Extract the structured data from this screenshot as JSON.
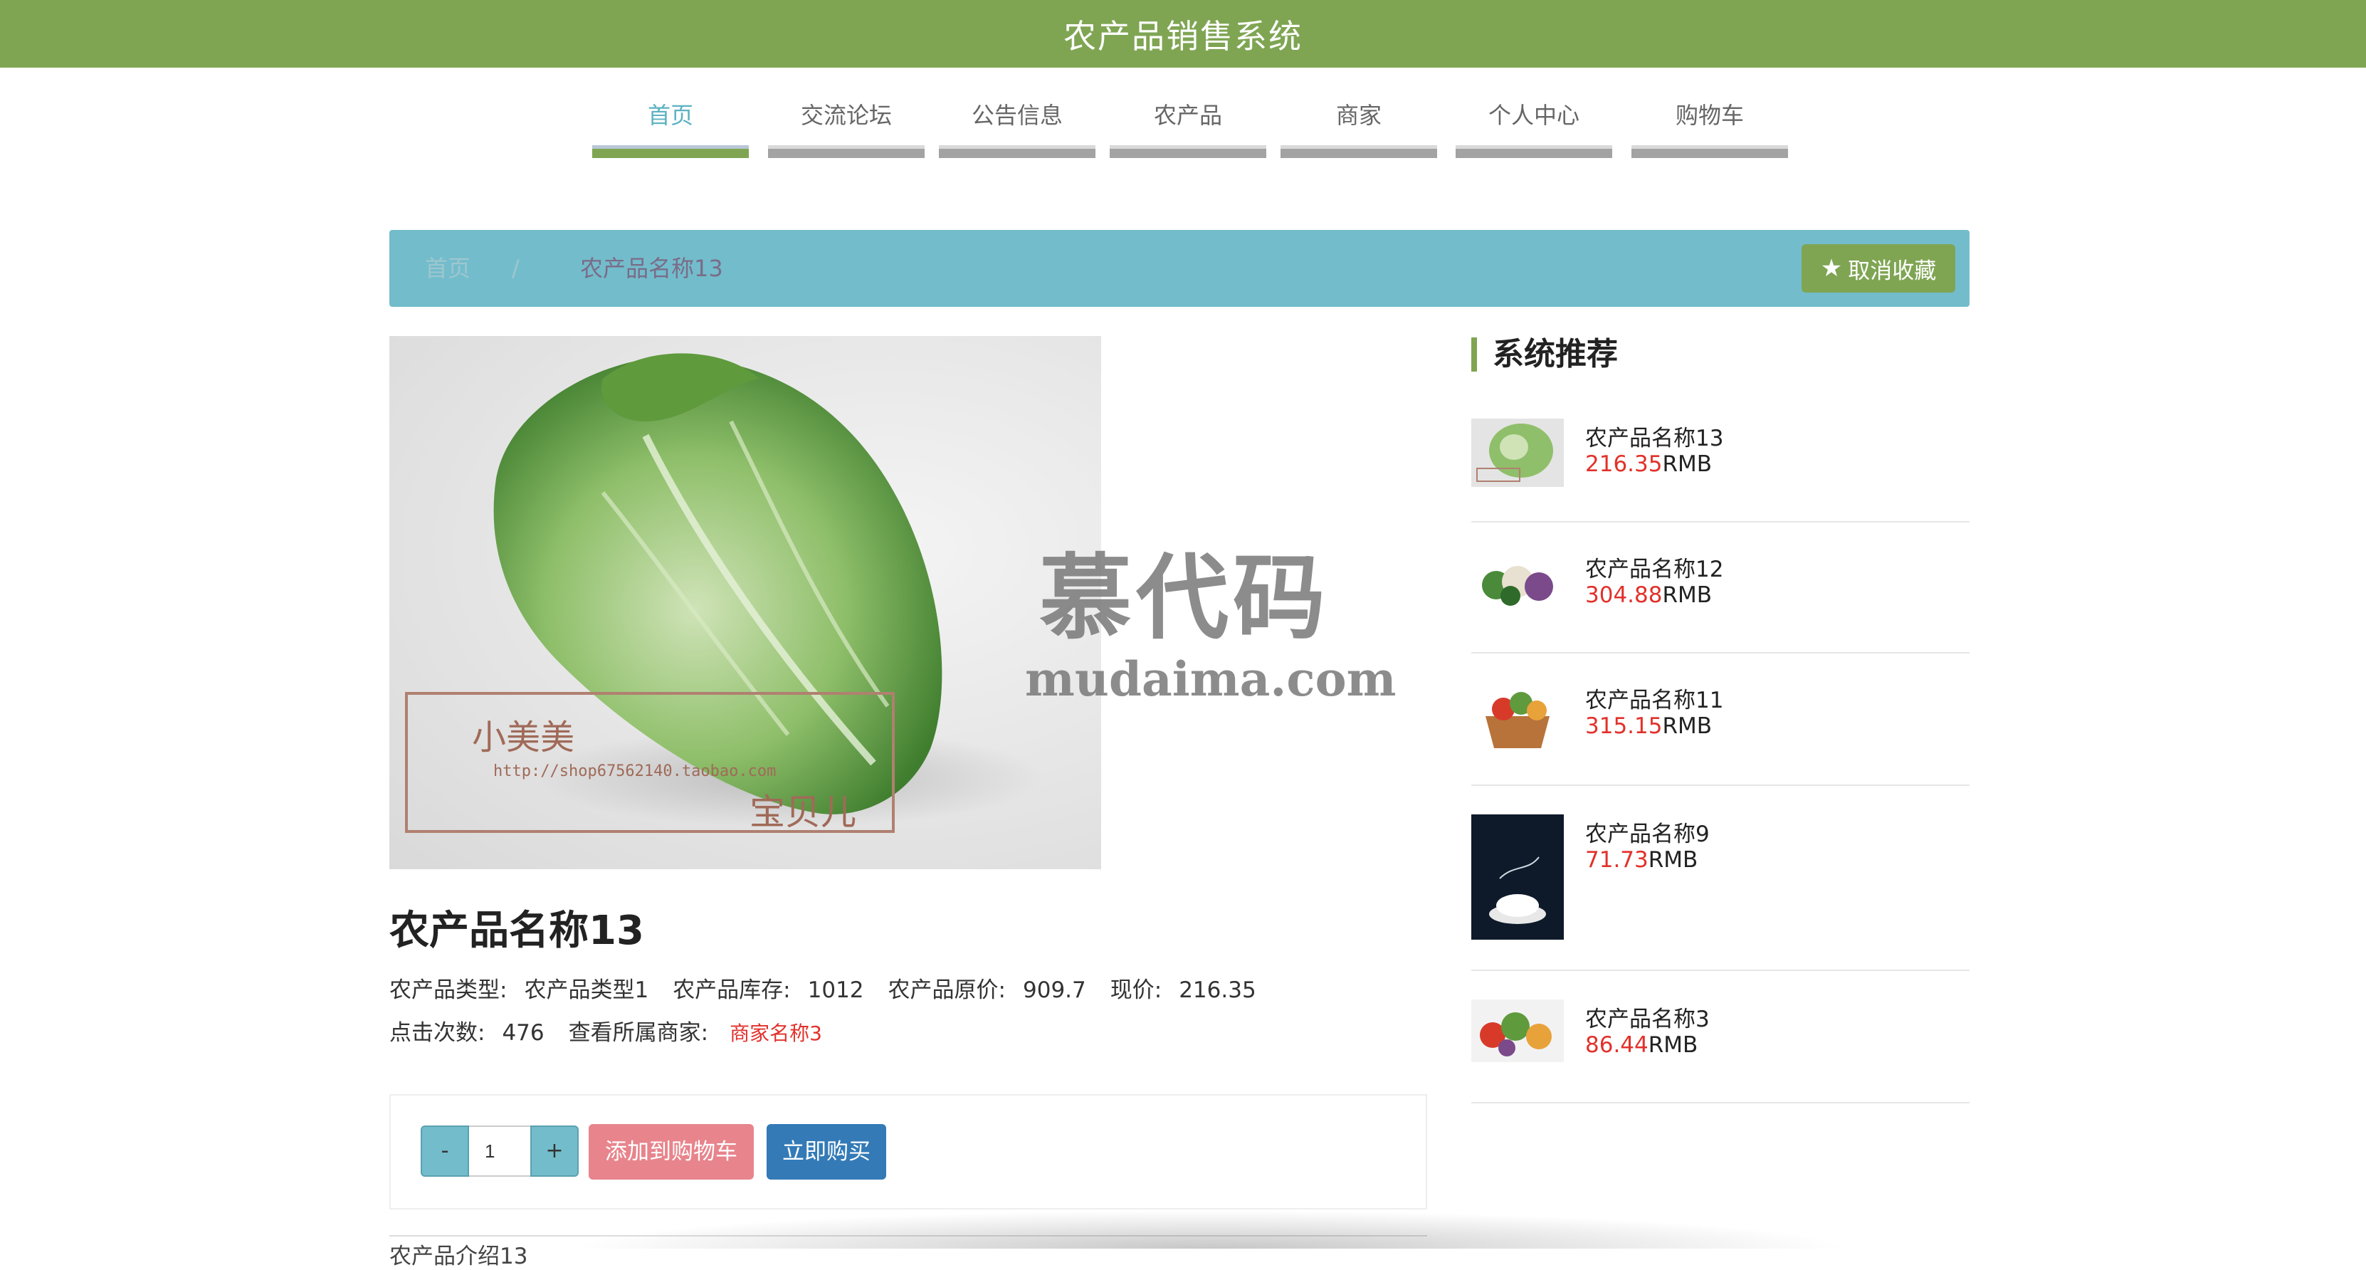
{
  "app": {
    "title": "农产品销售系统"
  },
  "nav": {
    "items": [
      {
        "label": "首页"
      },
      {
        "label": "交流论坛"
      },
      {
        "label": "公告信息"
      },
      {
        "label": "农产品"
      },
      {
        "label": "商家"
      },
      {
        "label": "个人中心"
      },
      {
        "label": "购物车"
      }
    ],
    "active": "首页"
  },
  "breadcrumb": {
    "home": "首页",
    "separator": "/",
    "current": "农产品名称13"
  },
  "favorite_button": {
    "label": "取消收藏",
    "icon": "star-icon"
  },
  "watermark": {
    "line1": "慕代码",
    "line2": "mudaima.com"
  },
  "image_stamp": {
    "line1": "小美美",
    "line2": "http://shop67562140.taobao.com",
    "line3": "宝贝儿"
  },
  "product": {
    "name": "农产品名称13",
    "type_label": "农产品类型:",
    "type_value": "农产品类型1",
    "stock_label": "农产品库存:",
    "stock_value": "1012",
    "original_price_label": "农产品原价:",
    "original_price_value": "909.7",
    "price_label": "现价:",
    "price_value": "216.35",
    "clicks_label": "点击次数:",
    "clicks_value": "476",
    "merchant_label": "查看所属商家:",
    "merchant_value": "商家名称3",
    "intro": "农产品介绍13"
  },
  "purchase": {
    "minus": "-",
    "plus": "+",
    "quantity": "1",
    "add_to_cart": "添加到购物车",
    "buy_now": "立即购买"
  },
  "sidebar": {
    "title": "系统推荐",
    "currency": "RMB",
    "items": [
      {
        "name": "农产品名称13",
        "price": "216.35"
      },
      {
        "name": "农产品名称12",
        "price": "304.88"
      },
      {
        "name": "农产品名称11",
        "price": "315.15"
      },
      {
        "name": "农产品名称9",
        "price": "71.73"
      },
      {
        "name": "农产品名称3",
        "price": "86.44"
      }
    ]
  },
  "colors": {
    "brand_green": "#7fa553",
    "breadcrumb_blue": "#73bccb",
    "price_red": "#e2312b",
    "add_cart_pink": "#e8848c",
    "buy_blue": "#337ab7"
  }
}
